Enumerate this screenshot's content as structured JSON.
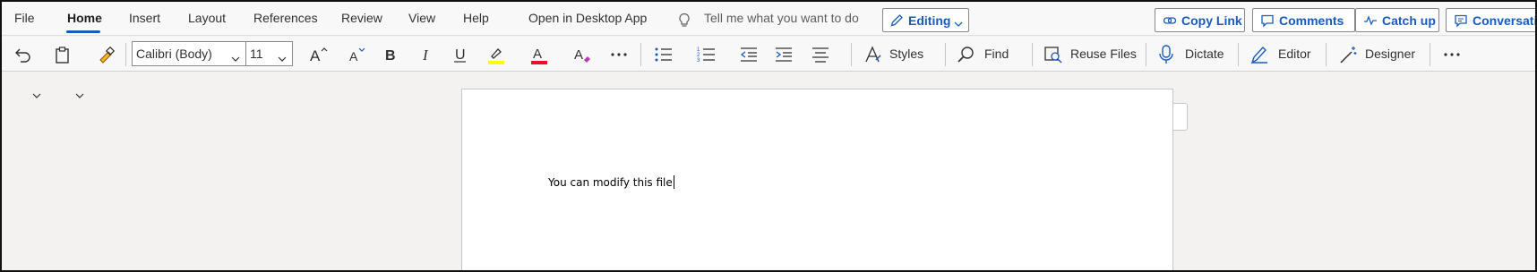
{
  "menu": {
    "tabs": [
      {
        "label": "File"
      },
      {
        "label": "Home",
        "active": true
      },
      {
        "label": "Insert"
      },
      {
        "label": "Layout"
      },
      {
        "label": "References"
      },
      {
        "label": "Review"
      },
      {
        "label": "View"
      },
      {
        "label": "Help"
      },
      {
        "label": "Open in Desktop App"
      }
    ],
    "tell_me": "Tell me what you want to do",
    "editing_mode": "Editing",
    "copy_link": "Copy Link",
    "comments": "Comments",
    "catch_up": "Catch up",
    "conversations": "Conversations"
  },
  "ribbon": {
    "font_name": "Calibri (Body)",
    "font_size": "11",
    "styles": "Styles",
    "find": "Find",
    "reuse_files": "Reuse Files",
    "dictate": "Dictate",
    "editor": "Editor",
    "designer": "Designer",
    "highlight_color": "#ffff00",
    "font_color": "#e81123",
    "accent_color": "#185abd"
  },
  "document": {
    "body_text": "You can modify this file"
  }
}
